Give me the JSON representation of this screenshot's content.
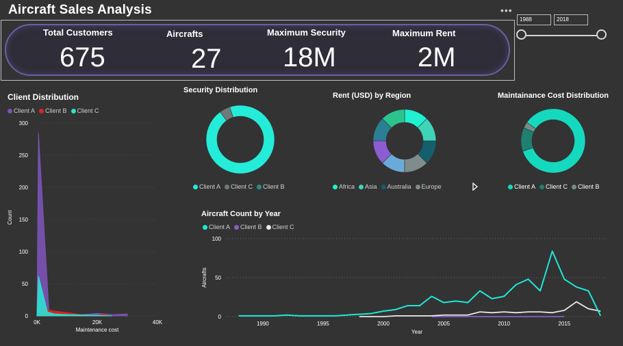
{
  "title": "Aircraft Sales Analysis",
  "more_icon": "ellipsis-icon",
  "kpis": [
    {
      "label": "Total Customers",
      "value": "675"
    },
    {
      "label": "Aircrafts",
      "value": "27"
    },
    {
      "label": "Maximum Security",
      "value": "18M"
    },
    {
      "label": "Maximum Rent",
      "value": "2M"
    }
  ],
  "slicer": {
    "start": "1988",
    "end": "2018"
  },
  "colors": {
    "client_a": "#1de9d6",
    "client_b_dist": "#e0222a",
    "client_c": "#2ee0cf",
    "client_a_dist": "#7a52b3",
    "client_b": "#8a5cc8",
    "client_c_line": "#e8e8e8"
  },
  "chart_data": [
    {
      "type": "area",
      "title": "Client Distribution",
      "xlabel": "Maintenance cost",
      "ylabel": "Count",
      "xticks": [
        "0K",
        "20K",
        "40K"
      ],
      "yticks": [
        "0",
        "50",
        "100",
        "150",
        "200",
        "250",
        "300"
      ],
      "xlim": [
        0,
        40000
      ],
      "ylim": [
        0,
        300
      ],
      "legend": [
        "Client A",
        "Client B",
        "Client C"
      ],
      "series": [
        {
          "name": "Client A",
          "color": "#7a52b3",
          "x": [
            0,
            500,
            4000,
            6000,
            10000,
            15000,
            20000,
            25000,
            30000
          ],
          "y": [
            0,
            285,
            5,
            2,
            3,
            2,
            4,
            2,
            3
          ]
        },
        {
          "name": "Client B",
          "color": "#e0222a",
          "x": [
            0,
            2000,
            5000,
            10000,
            15000,
            20000,
            22000,
            24000
          ],
          "y": [
            0,
            12,
            8,
            5,
            2,
            1,
            3,
            0
          ]
        },
        {
          "name": "Client C",
          "color": "#2ee0cf",
          "x": [
            0,
            500,
            3500,
            6000,
            10000,
            20000,
            25000
          ],
          "y": [
            0,
            62,
            6,
            3,
            2,
            1,
            0
          ]
        }
      ]
    },
    {
      "type": "pie",
      "title": "Security Distribution",
      "labels": [
        "Client A",
        "Client C",
        "Client B"
      ],
      "values": [
        95,
        5,
        0
      ],
      "colors": [
        "#25ecd9",
        "#6f7b7a",
        "#2a8f84"
      ]
    },
    {
      "type": "pie",
      "title": "Rent (USD) by Region",
      "labels": [
        "Africa",
        "Asia",
        "Australia",
        "Europe"
      ],
      "values": [
        12,
        12,
        12,
        12,
        12,
        12,
        12,
        12
      ],
      "slice_colors": [
        "#21f0d2",
        "#3fd4b8",
        "#135f6e",
        "#7f8c8c",
        "#6aaad8",
        "#8d5cd0",
        "#2a7f95",
        "#2bc48d"
      ],
      "legend_colors": [
        "#21f0d2",
        "#3fd4b8",
        "#135f6e",
        "#7f8c8c"
      ]
    },
    {
      "type": "pie",
      "title": "Maintainance Cost Distribution",
      "labels": [
        "Client A",
        "Client C",
        "Client B"
      ],
      "values": [
        85,
        12,
        3
      ],
      "colors": [
        "#15d9bf",
        "#1f7f70",
        "#6f8e88"
      ]
    },
    {
      "type": "line",
      "title": "Aircraft Count by Year",
      "xlabel": "Year",
      "ylabel": "Aircrafts",
      "xticks": [
        "1990",
        "1995",
        "2000",
        "2005",
        "2010",
        "2015"
      ],
      "yticks": [
        "0",
        "50",
        "100"
      ],
      "xlim": [
        1987,
        2018.5
      ],
      "ylim": [
        0,
        100
      ],
      "legend": [
        "Client A",
        "Client B",
        "Client C"
      ],
      "series": [
        {
          "name": "Client A",
          "color": "#1de9d6",
          "x": [
            1988,
            1989,
            1990,
            1991,
            1992,
            1993,
            1994,
            1995,
            1996,
            1997,
            1998,
            1999,
            2000,
            2001,
            2002,
            2003,
            2004,
            2005,
            2006,
            2007,
            2008,
            2009,
            2010,
            2011,
            2012,
            2013,
            2014,
            2015,
            2016,
            2017,
            2018
          ],
          "y": [
            1,
            1,
            1,
            1,
            2,
            1,
            1,
            1,
            1,
            2,
            3,
            4,
            7,
            9,
            14,
            14,
            26,
            18,
            20,
            18,
            33,
            23,
            26,
            41,
            48,
            33,
            84,
            48,
            38,
            33,
            1
          ]
        },
        {
          "name": "Client B",
          "color": "#8a5cc8",
          "x": [
            2004,
            2005,
            2006,
            2007,
            2008,
            2009,
            2010,
            2011,
            2012,
            2013,
            2014,
            2015
          ],
          "y": [
            0,
            0,
            0,
            0,
            0,
            0,
            0,
            0,
            0,
            0,
            0,
            0
          ]
        },
        {
          "name": "Client C",
          "color": "#e8e8e8",
          "x": [
            1998,
            1999,
            2000,
            2001,
            2002,
            2003,
            2004,
            2005,
            2006,
            2007,
            2008,
            2009,
            2010,
            2011,
            2012,
            2013,
            2014,
            2015,
            2016,
            2017,
            2018
          ],
          "y": [
            0,
            0,
            0,
            1,
            1,
            1,
            1,
            2,
            2,
            2,
            6,
            5,
            6,
            5,
            6,
            6,
            5,
            8,
            19,
            10,
            7
          ]
        }
      ]
    }
  ]
}
